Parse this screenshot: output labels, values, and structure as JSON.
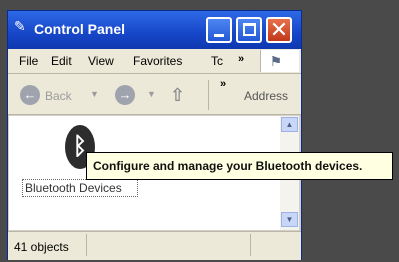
{
  "window": {
    "title": "Control Panel",
    "title_icon": "control-panel-icon",
    "buttons": {
      "minimize": "minimize-icon",
      "maximize": "maximize-icon",
      "close": "close-icon"
    }
  },
  "menubar": {
    "items": [
      "File",
      "Edit",
      "View",
      "Favorites",
      "Tc",
      "»"
    ],
    "flag_icon": "windows-flag-icon"
  },
  "toolbar": {
    "back_label": "Back",
    "overflow_chevron": "»",
    "address_label": "Address",
    "icons": [
      "back-arrow-icon",
      "forward-arrow-icon",
      "up-folder-icon"
    ]
  },
  "content": {
    "items": [
      {
        "label": "Bluetooth Devices",
        "icon": "bluetooth-icon"
      }
    ],
    "tooltip": "Configure and manage your Bluetooth devices."
  },
  "status": {
    "object_count": "41 objects"
  }
}
